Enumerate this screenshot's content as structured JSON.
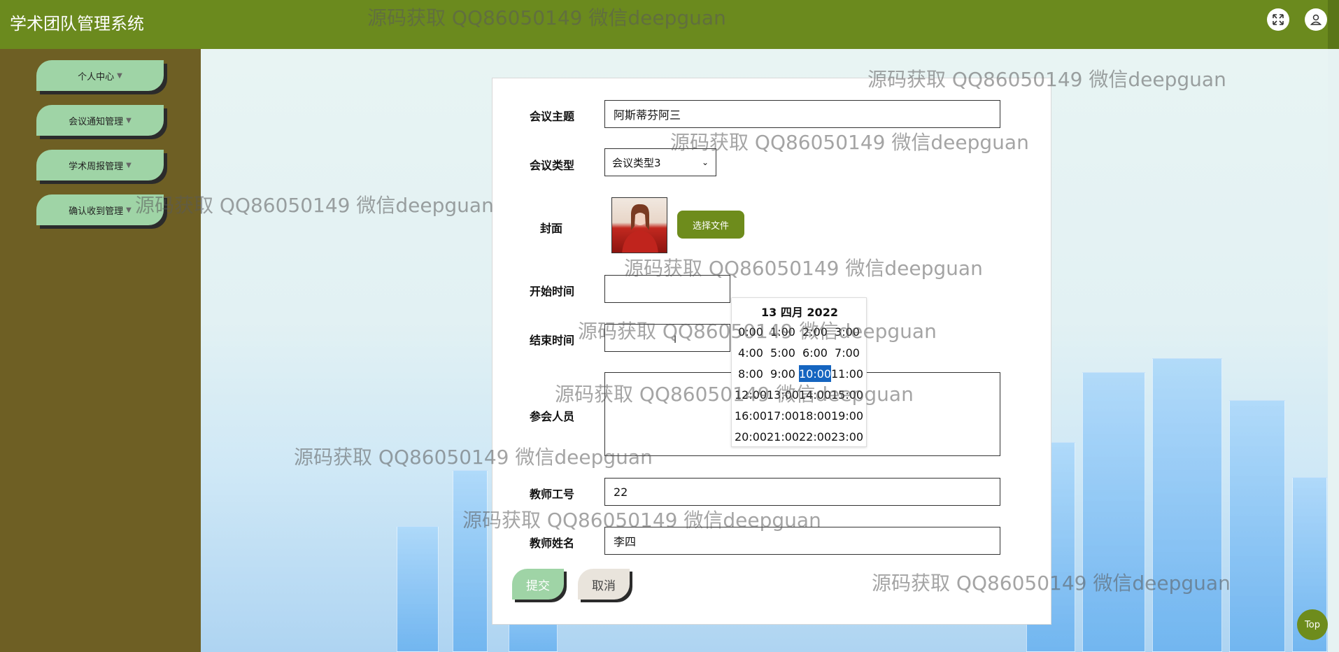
{
  "app": {
    "title": "学术团队管理系统"
  },
  "topbar": {
    "icons": [
      "fullscreen-icon",
      "user-icon"
    ]
  },
  "sidebar": {
    "items": [
      {
        "label": "个人中心"
      },
      {
        "label": "会议通知管理"
      },
      {
        "label": "学术周报管理"
      },
      {
        "label": "确认收到管理"
      }
    ]
  },
  "form": {
    "topic_label": "会议主题",
    "topic_value": "阿斯蒂芬阿三",
    "type_label": "会议类型",
    "type_value": "会议类型3",
    "cover_label": "封面",
    "pick_file_label": "选择文件",
    "start_label": "开始时间",
    "start_value": "",
    "end_label": "结束时间",
    "end_value": "",
    "attendees_label": "参会人员",
    "attendees_value": "",
    "teacher_id_label": "教师工号",
    "teacher_id_value": "22",
    "teacher_name_label": "教师姓名",
    "teacher_name_value": "李四",
    "submit_label": "提交",
    "cancel_label": "取消"
  },
  "datetime_picker": {
    "date": "13 四月 2022",
    "times": [
      "0:00",
      "1:00",
      "2:00",
      "3:00",
      "4:00",
      "5:00",
      "6:00",
      "7:00",
      "8:00",
      "9:00",
      "10:00",
      "11:00",
      "12:00",
      "13:00",
      "14:00",
      "15:00",
      "16:00",
      "17:00",
      "18:00",
      "19:00",
      "20:00",
      "21:00",
      "22:00",
      "23:00"
    ],
    "selected": "10:00"
  },
  "watermark": {
    "text": "源码获取 QQ86050149 微信deepguan"
  },
  "back_to_top": {
    "label": "Top"
  },
  "colors": {
    "topbar": "#6b8a1e",
    "sidebar": "#6e5f24",
    "menu_button": "#9fd4a6",
    "accent": "#6e8c1c",
    "selected_time": "#1565c0"
  }
}
